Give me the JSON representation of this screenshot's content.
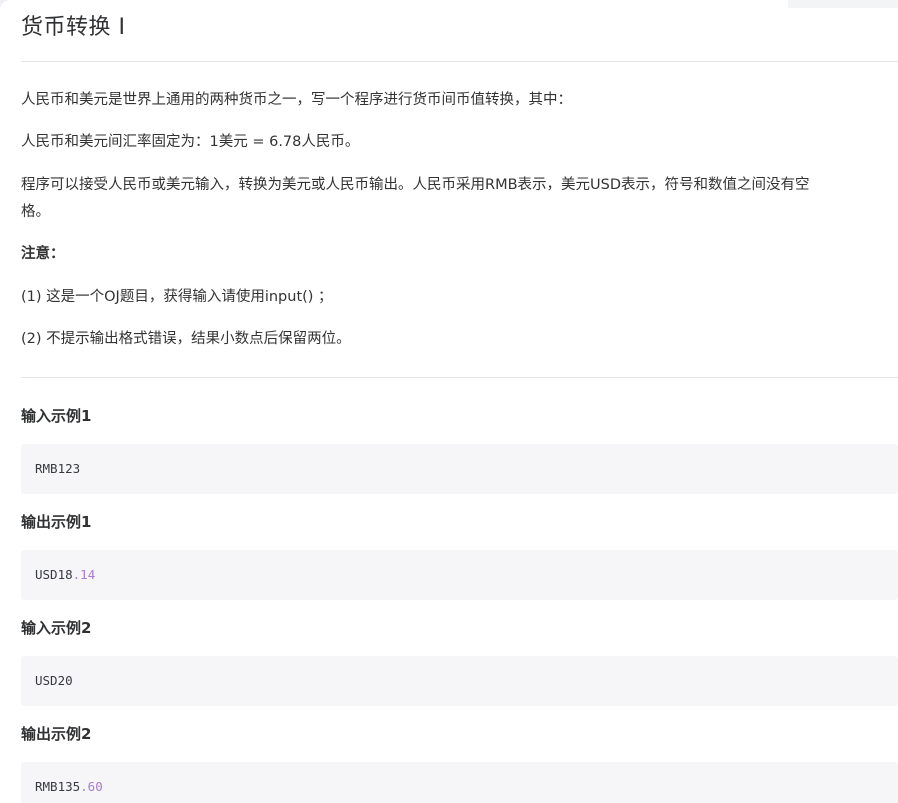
{
  "page": {
    "title": "货币转换 I"
  },
  "description": {
    "p1": "人民币和美元是世界上通用的两种货币之一，写一个程序进行货币间币值转换，其中：",
    "p2": "人民币和美元间汇率固定为：1美元 = 6.78人民币。",
    "p3_line1": "程序可以接受人民币或美元输入，转换为美元或人民币输出。人民币采用RMB表示，美元USD表示，符号和数值之间没有空",
    "p3_line2": "格。",
    "note_label": "注意：",
    "note1": "(1) 这是一个OJ题目，获得输入请使用input() ；",
    "note2": "(2) 不提示输出格式错误，结果小数点后保留两位。"
  },
  "examples": [
    {
      "heading": "输入示例1",
      "code_prefix": "RMB123",
      "code_number": ""
    },
    {
      "heading": "输出示例1",
      "code_prefix": "USD18",
      "code_number": ".14"
    },
    {
      "heading": "输入示例2",
      "code_prefix": "USD20",
      "code_number": ""
    },
    {
      "heading": "输出示例2",
      "code_prefix": "RMB135",
      "code_number": ".60"
    }
  ],
  "colors": {
    "background": "#eef0f3",
    "card": "#ffffff",
    "code_bg": "#f6f6f8",
    "number_highlight": "#a77ccb"
  }
}
